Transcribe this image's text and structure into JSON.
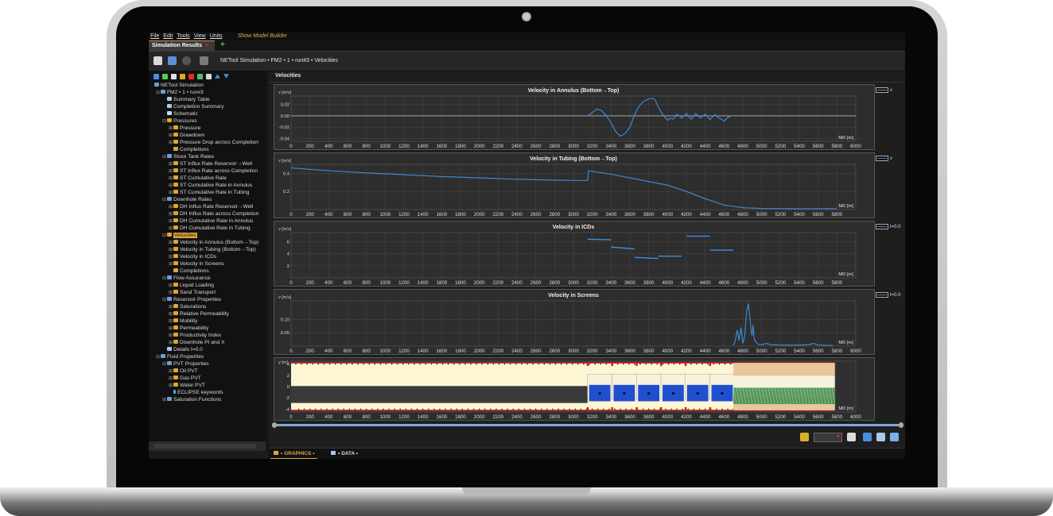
{
  "menu": {
    "items": [
      "File",
      "Edit",
      "Tools",
      "View",
      "Units"
    ],
    "builder_label": "Show Model Builder"
  },
  "tabs": {
    "active_label": "Simulation Results",
    "close_glyph": "×",
    "add_glyph": "+"
  },
  "toolbar": {
    "breadcrumb": "NETool Simulation • FM2 • 1 • run#3 • Velocities",
    "icons": [
      "open-folder-icon",
      "save-icon",
      "refresh-icon",
      "copy-icon"
    ]
  },
  "tree_toolbar_icons": [
    "connect-icon",
    "cut-icon",
    "copy-icon",
    "paste-icon",
    "delete-icon",
    "export-icon",
    "import-icon",
    "move-up-icon",
    "move-down-icon"
  ],
  "tree": [
    {
      "label": "NETool Simulation",
      "icon": "folder",
      "level": 0,
      "expander": ""
    },
    {
      "label": "FM2 • 1 • run#3",
      "icon": "folder",
      "level": 1,
      "expander": "⊟"
    },
    {
      "label": "Summary Table",
      "icon": "table",
      "level": 2,
      "expander": ""
    },
    {
      "label": "Completion Summary",
      "icon": "table",
      "level": 2,
      "expander": ""
    },
    {
      "label": "Schematic",
      "icon": "doc",
      "level": 2,
      "expander": ""
    },
    {
      "label": "Pressures",
      "icon": "chart",
      "level": 2,
      "expander": "⊟"
    },
    {
      "label": "Pressure",
      "icon": "chart",
      "level": 3,
      "expander": "⊞"
    },
    {
      "label": "Drawdown",
      "icon": "chart",
      "level": 3,
      "expander": "⊞"
    },
    {
      "label": "Pressure Drop across Completion",
      "icon": "chart",
      "level": 3,
      "expander": "⊞"
    },
    {
      "label": "Completions",
      "icon": "chart",
      "level": 3,
      "expander": ""
    },
    {
      "label": "Stock Tank Rates",
      "icon": "folder",
      "level": 2,
      "expander": "⊟"
    },
    {
      "label": "ST Influx Rate Reservoir→Well",
      "icon": "chart",
      "level": 3,
      "expander": "⊞"
    },
    {
      "label": "ST Influx Rate across Completion",
      "icon": "chart",
      "level": 3,
      "expander": "⊞"
    },
    {
      "label": "ST Cumulative Rate",
      "icon": "chart",
      "level": 3,
      "expander": "⊞"
    },
    {
      "label": "ST Cumulative Rate in Annulus",
      "icon": "chart",
      "level": 3,
      "expander": "⊞"
    },
    {
      "label": "ST Cumulative Rate in Tubing",
      "icon": "chart",
      "level": 3,
      "expander": "⊞"
    },
    {
      "label": "Downhole Rates",
      "icon": "folder",
      "level": 2,
      "expander": "⊟"
    },
    {
      "label": "DH Influx Rate Reservoir→Well",
      "icon": "chart",
      "level": 3,
      "expander": "⊞"
    },
    {
      "label": "DH Influx Rate across Completion",
      "icon": "chart",
      "level": 3,
      "expander": "⊞"
    },
    {
      "label": "DH Cumulative Rate in Annulus",
      "icon": "chart",
      "level": 3,
      "expander": "⊞"
    },
    {
      "label": "DH Cumulative Rate in Tubing",
      "icon": "chart",
      "level": 3,
      "expander": "⊞"
    },
    {
      "label": "Velocities",
      "icon": "chart",
      "level": 2,
      "expander": "⊟",
      "selected": true
    },
    {
      "label": "Velocity in Annulus  (Bottom→Top)",
      "icon": "chart",
      "level": 3,
      "expander": "⊞"
    },
    {
      "label": "Velocity in Tubing  (Bottom→Top)",
      "icon": "chart",
      "level": 3,
      "expander": "⊞"
    },
    {
      "label": "Velocity in ICDs",
      "icon": "chart",
      "level": 3,
      "expander": "⊞"
    },
    {
      "label": "Velocity in Screens",
      "icon": "chart",
      "level": 3,
      "expander": "⊞"
    },
    {
      "label": "Completions",
      "icon": "chart",
      "level": 3,
      "expander": ""
    },
    {
      "label": "Flow Assurance",
      "icon": "folder",
      "level": 2,
      "expander": "⊟"
    },
    {
      "label": "Liquid Loading",
      "icon": "chart",
      "level": 3,
      "expander": "⊞"
    },
    {
      "label": "Sand Transport",
      "icon": "chart",
      "level": 3,
      "expander": "⊞"
    },
    {
      "label": "Reservoir Properties",
      "icon": "folder",
      "level": 2,
      "expander": "⊟"
    },
    {
      "label": "Saturations",
      "icon": "chart",
      "level": 3,
      "expander": "⊞"
    },
    {
      "label": "Relative Permeability",
      "icon": "chart",
      "level": 3,
      "expander": "⊞"
    },
    {
      "label": "Mobility",
      "icon": "chart",
      "level": 3,
      "expander": "⊞"
    },
    {
      "label": "Permeability",
      "icon": "chart",
      "level": 3,
      "expander": "⊞"
    },
    {
      "label": "Productivity Index",
      "icon": "chart",
      "level": 3,
      "expander": "⊞"
    },
    {
      "label": "Downhole PI and X",
      "icon": "chart",
      "level": 3,
      "expander": "⊞"
    },
    {
      "label": "Details  t=0.0",
      "icon": "table",
      "level": 2,
      "expander": ""
    },
    {
      "label": "Fluid Properties",
      "icon": "folder",
      "level": 1,
      "expander": "⊟"
    },
    {
      "label": "PVT Properties",
      "icon": "folder",
      "level": 2,
      "expander": "⊟"
    },
    {
      "label": "Oil PVT",
      "icon": "chart",
      "level": 3,
      "expander": "⊞"
    },
    {
      "label": "Gas PVT",
      "icon": "chart",
      "level": 3,
      "expander": "⊞"
    },
    {
      "label": "Water PVT",
      "icon": "chart",
      "level": 3,
      "expander": "⊞"
    },
    {
      "label": "ECLIPSE keywords",
      "icon": "eclipse",
      "level": 3,
      "expander": ""
    },
    {
      "label": "Saturation Functions",
      "icon": "folder",
      "level": 2,
      "expander": "⊞"
    }
  ],
  "main": {
    "title": "Velocities",
    "bottom_tabs": {
      "graphics": "• GRAPHICS •",
      "data": "• DATA •"
    }
  },
  "chart_data": [
    {
      "type": "line",
      "title": "Velocity in Annulus  (Bottom→Top)",
      "ylabel": "v [m/s]",
      "xlabel": "MD [m]",
      "legend": "v",
      "xlim": [
        0,
        6000
      ],
      "ylim": [
        -0.045,
        0.035
      ],
      "yticks": [
        0.02,
        0.0,
        -0.02,
        -0.04
      ],
      "ytick_labels": [
        "0.02",
        "0.00",
        "-0.02",
        "-0.04"
      ],
      "xticks": [
        0,
        200,
        400,
        600,
        800,
        1000,
        1200,
        1400,
        1600,
        1800,
        2000,
        2200,
        2400,
        2600,
        2800,
        3000,
        3200,
        3400,
        3600,
        3800,
        4000,
        4200,
        4400,
        4600,
        4800,
        5000,
        5200,
        5400,
        5600,
        5800,
        6000
      ],
      "grid": true,
      "zero_line": true,
      "series": [
        {
          "name": "v",
          "color": "#3d8fe0",
          "x": [
            3150,
            3200,
            3250,
            3300,
            3350,
            3400,
            3450,
            3500,
            3550,
            3600,
            3650,
            3700,
            3750,
            3800,
            3850,
            3870,
            3900,
            3950,
            4000,
            4030,
            4060,
            4100,
            4150,
            4200,
            4250,
            4300,
            4350,
            4400,
            4450,
            4500,
            4550,
            4600,
            4640,
            4680
          ],
          "y": [
            0.0,
            0.006,
            0.012,
            0.009,
            0.0,
            -0.012,
            -0.028,
            -0.036,
            -0.031,
            -0.02,
            0.002,
            0.018,
            0.026,
            0.03,
            0.031,
            0.028,
            0.016,
            0.002,
            -0.008,
            -0.004,
            -0.006,
            0.003,
            -0.004,
            0.004,
            -0.006,
            0.004,
            -0.004,
            0.003,
            -0.007,
            0.002,
            -0.004,
            -0.009,
            -0.003,
            0.0
          ]
        }
      ]
    },
    {
      "type": "line",
      "title": "Velocity in Tubing  (Bottom→Top)",
      "ylabel": "v [m/s]",
      "xlabel": "MD [m]",
      "legend": "v",
      "xlim": [
        0,
        6000
      ],
      "ylim": [
        0,
        0.5
      ],
      "yticks": [
        0.4,
        0.2
      ],
      "ytick_labels": [
        "0.4",
        "0.2"
      ],
      "xticks": [
        0,
        200,
        400,
        600,
        800,
        1000,
        1200,
        1400,
        1600,
        1800,
        2000,
        2200,
        2400,
        2600,
        2800,
        3000,
        3200,
        3400,
        3600,
        3800,
        4000,
        4200,
        4400,
        4600,
        4800,
        5000,
        5200,
        5400,
        5600,
        5800
      ],
      "grid": true,
      "series": [
        {
          "name": "v",
          "color": "#3d8fe0",
          "x": [
            0,
            400,
            800,
            1200,
            1600,
            2000,
            2400,
            2800,
            3150,
            3160,
            3400,
            3600,
            3800,
            4000,
            4200,
            4400,
            4600,
            4700,
            4800,
            5000,
            5400,
            5800
          ],
          "y": [
            0.46,
            0.43,
            0.405,
            0.385,
            0.365,
            0.35,
            0.335,
            0.325,
            0.32,
            0.43,
            0.39,
            0.35,
            0.31,
            0.27,
            0.2,
            0.12,
            0.05,
            0.035,
            0.02,
            0.012,
            0.01,
            0.01
          ]
        }
      ]
    },
    {
      "type": "line",
      "title": "Velocity in ICDs",
      "ylabel": "v [m/s]",
      "xlabel": "MD [m]",
      "legend": "t=0.0",
      "xlim": [
        0,
        6000
      ],
      "ylim": [
        0,
        7.5
      ],
      "yticks": [
        6,
        4,
        2
      ],
      "ytick_labels": [
        "6",
        "4",
        "2"
      ],
      "xticks": [
        0,
        200,
        400,
        600,
        800,
        1000,
        1200,
        1400,
        1600,
        1800,
        2000,
        2200,
        2400,
        2600,
        2800,
        3000,
        3200,
        3400,
        3600,
        3800,
        4000,
        4200,
        4400,
        4600,
        4800,
        5000,
        5200,
        5400,
        5600,
        5800
      ],
      "grid": true,
      "segments": [
        {
          "x": [
            3150,
            3400
          ],
          "y": [
            6.4,
            6.3
          ]
        },
        {
          "x": [
            3400,
            3650
          ],
          "y": [
            5.1,
            4.8
          ]
        },
        {
          "x": [
            3650,
            3900
          ],
          "y": [
            3.4,
            3.2
          ]
        },
        {
          "x": [
            3900,
            4150
          ],
          "y": [
            3.6,
            3.6
          ]
        },
        {
          "x": [
            4200,
            4450
          ],
          "y": [
            6.9,
            6.9
          ]
        },
        {
          "x": [
            4450,
            4700
          ],
          "y": [
            4.6,
            4.6
          ]
        }
      ]
    },
    {
      "type": "line",
      "title": "Velocity in Screens",
      "ylabel": "v [m/s]",
      "xlabel": "MD [m]",
      "legend": "t=0.0",
      "xlim": [
        0,
        6000
      ],
      "ylim": [
        0,
        0.17
      ],
      "yticks": [
        0.1,
        0.05
      ],
      "ytick_labels": [
        "0.10",
        "0.05"
      ],
      "xticks": [
        0,
        200,
        400,
        600,
        800,
        1000,
        1200,
        1400,
        1600,
        1800,
        2000,
        2200,
        2400,
        2600,
        2800,
        3000,
        3200,
        3400,
        3600,
        3800,
        4000,
        4200,
        4400,
        4600,
        4800,
        5000,
        5200,
        5400,
        5600,
        5800,
        6000
      ],
      "grid": true,
      "series": [
        {
          "name": "t=0.0",
          "color": "#3d8fe0",
          "x": [
            4700,
            4720,
            4740,
            4760,
            4780,
            4800,
            4820,
            4840,
            4860,
            4870,
            4880,
            4890,
            4900,
            4910,
            4920,
            4930,
            4950,
            4970,
            5000,
            5050,
            5100,
            5200,
            5300,
            5400,
            5500,
            5550,
            5600,
            5700,
            5760
          ],
          "y": [
            0.002,
            0.02,
            0.06,
            0.02,
            0.07,
            0.01,
            0.04,
            0.13,
            0.16,
            0.12,
            0.09,
            0.05,
            0.04,
            0.08,
            0.03,
            0.02,
            0.01,
            0.006,
            0.005,
            0.01,
            0.005,
            0.004,
            0.004,
            0.004,
            0.005,
            0.01,
            0.004,
            0.003,
            0.003
          ]
        }
      ]
    },
    {
      "type": "other",
      "description_label": "completion schematic",
      "ylabel": "y [m]",
      "xlabel": "MD [m]",
      "xlim": [
        0,
        6000
      ],
      "ylim": [
        -4.5,
        4.5
      ],
      "yticks": [
        4,
        2,
        0,
        -2,
        -4
      ],
      "ytick_labels": [
        "4",
        "2",
        "0",
        "-2",
        "-4"
      ],
      "xticks": [
        0,
        200,
        400,
        600,
        800,
        1000,
        1200,
        1400,
        1600,
        1800,
        2000,
        2200,
        2400,
        2600,
        2800,
        3000,
        3200,
        3400,
        3600,
        3800,
        4000,
        4200,
        4400,
        4600,
        4800,
        5000,
        5200,
        5400,
        5600,
        5800,
        6000
      ],
      "blank_pipe_end_md": 3150,
      "icd_joints_start_md": [
        3150,
        3410,
        3670,
        3930,
        4190,
        4450
      ],
      "icd_joint_length_md": 260,
      "screen_section_md": [
        4700,
        5780
      ],
      "colors": {
        "pipe_fill": "#fdf6d2",
        "tubing": "#3a3a3a",
        "icd": "#1f4fd0",
        "casing": "#d02020",
        "screen": "#3b8a4a",
        "rock": "#e9c79a"
      }
    }
  ]
}
